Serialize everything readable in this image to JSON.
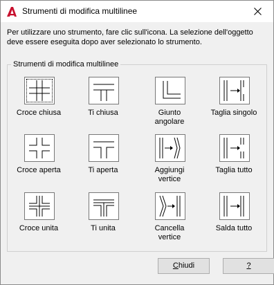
{
  "window": {
    "title": "Strumenti di modifica multilinee"
  },
  "description": {
    "line1": "Per utilizzare uno strumento, fare clic sull'icona. La selezione dell'oggetto",
    "line2": "deve essere eseguita dopo aver selezionato lo strumento."
  },
  "group": {
    "label": "Strumenti di modifica multilinee"
  },
  "tools": [
    {
      "label": "Croce chiusa",
      "icon": "closed-cross-icon"
    },
    {
      "label": "Ti chiusa",
      "icon": "closed-tee-icon"
    },
    {
      "label": "Giunto angolare",
      "line1": "Giunto",
      "line2": "angolare",
      "icon": "corner-joint-icon"
    },
    {
      "label": "Taglia singolo",
      "icon": "cut-single-icon"
    },
    {
      "label": "Croce aperta",
      "icon": "open-cross-icon"
    },
    {
      "label": "Ti aperta",
      "icon": "open-tee-icon"
    },
    {
      "label": "Aggiungi vertice",
      "line1": "Aggiungi",
      "line2": "vertice",
      "icon": "add-vertex-icon"
    },
    {
      "label": "Taglia tutto",
      "icon": "cut-all-icon"
    },
    {
      "label": "Croce unita",
      "icon": "merged-cross-icon"
    },
    {
      "label": "Ti unita",
      "icon": "merged-tee-icon"
    },
    {
      "label": "Cancella vertice",
      "line1": "Cancella",
      "line2": "vertice",
      "icon": "delete-vertex-icon"
    },
    {
      "label": "Salda tutto",
      "icon": "weld-all-icon"
    }
  ],
  "buttons": {
    "close": {
      "accel": "C",
      "rest": "hiudi"
    },
    "help": {
      "label": "?"
    }
  },
  "colors": {
    "app_icon": "#c8102e",
    "dialog_bg": "#f0f0f0",
    "title_bg": "#ffffff"
  }
}
